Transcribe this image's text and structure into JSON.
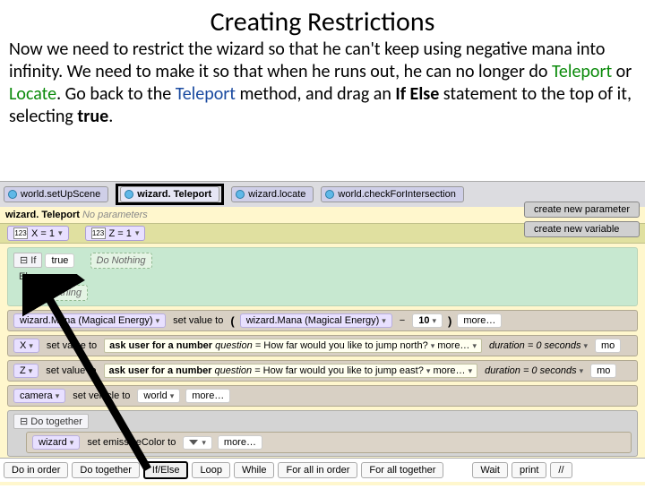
{
  "title": "Creating Restrictions",
  "para": {
    "t1": "Now we need to restrict the wizard so that he can't keep using negative mana into infinity. We need to make it so that when he runs out, he can no longer do ",
    "hl1": "Teleport",
    "t2": " or ",
    "hl2": "Locate",
    "t3": ". Go back to the ",
    "hl3": "Teleport",
    "t4": " method, and drag an ",
    "bold1": "If Else",
    "t5": " statement to the top of it, selecting ",
    "bold2": "true",
    "t6": "."
  },
  "tabs": {
    "t0": "world.setUpScene",
    "t1": "wizard. Teleport",
    "t2": "wizard.locate",
    "t3": "world.checkForIntersection"
  },
  "method": {
    "name": "wizard. Teleport",
    "params": "No parameters"
  },
  "buttons": {
    "newparam": "create new parameter",
    "newvar": "create new variable"
  },
  "vars": {
    "x": "X = 1",
    "z": "Z = 1"
  },
  "if": {
    "hdr": "If",
    "cond": "true",
    "nothing": "Do Nothing",
    "else": "Else"
  },
  "mana": {
    "lhs": "wizard.Mana (Magical Energy)",
    "set": "set  value to",
    "rhs": "wizard.Mana (Magical Energy)",
    "minus": "−",
    "val": "10",
    "more": "more…"
  },
  "rowX": {
    "var": "X",
    "set": "set  value to",
    "ask": "ask user for a number",
    "qlabel": "question =",
    "qtext": "How far would you like to jump north?",
    "more": "more…",
    "durlabel": "duration = 0 seconds",
    "more2": "mo"
  },
  "rowZ": {
    "var": "Z",
    "set": "set  value to",
    "ask": "ask user for a number",
    "qlabel": "question =",
    "qtext": "How far would you like to jump east?",
    "more": "more…",
    "durlabel": "duration = 0 seconds",
    "more2": "mo"
  },
  "cam": {
    "obj": "camera",
    "set": "set  vehicle to",
    "val": "world",
    "more": "more…"
  },
  "together": {
    "hdr": "Do together"
  },
  "emissive": {
    "obj": "wizard",
    "set": "set  emissiveColor  to",
    "more": "more…"
  },
  "palette": {
    "p0": "Do in order",
    "p1": "Do together",
    "p2": "If/Else",
    "p3": "Loop",
    "p4": "While",
    "p5": "For all in order",
    "p6": "For all together",
    "p7": "Wait",
    "p8": "print"
  }
}
